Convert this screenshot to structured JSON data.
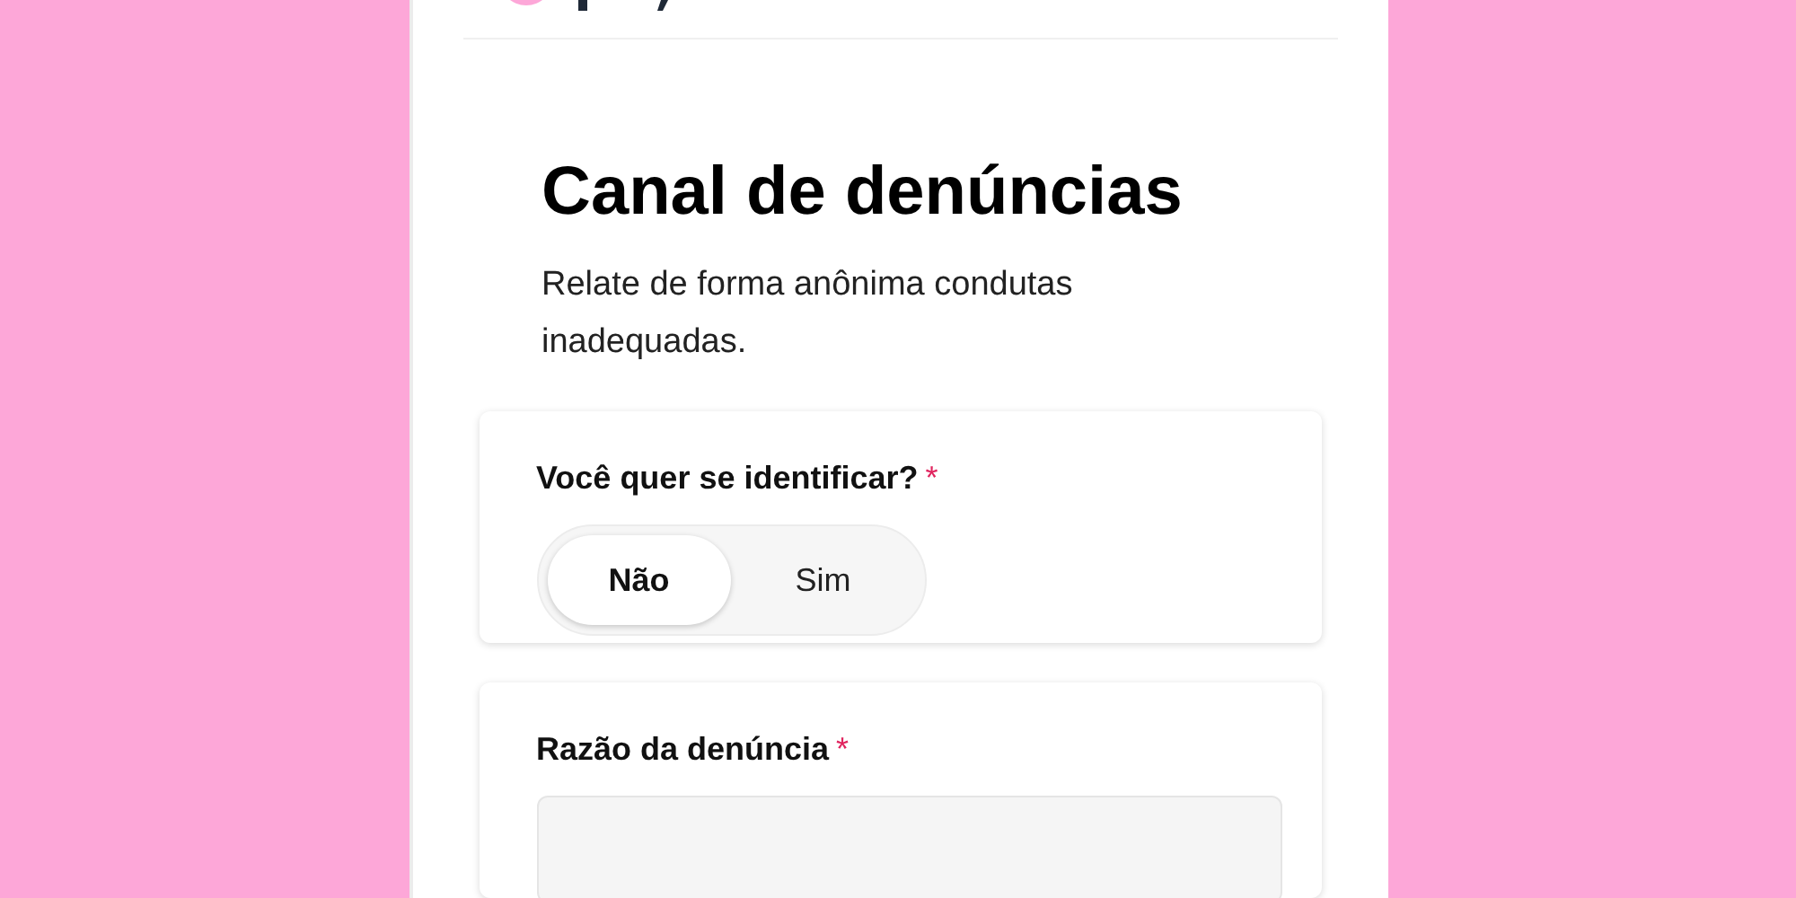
{
  "title": "Canal de denúncias",
  "subtitle": "Relate de forma anônima condutas inadequadas.",
  "identify": {
    "label": "Você quer se identificar?",
    "required_mark": "*",
    "options": [
      {
        "label": "Não",
        "selected": true
      },
      {
        "label": "Sim",
        "selected": false
      }
    ]
  },
  "reason": {
    "label": "Razão da denúncia",
    "required_mark": "*"
  }
}
